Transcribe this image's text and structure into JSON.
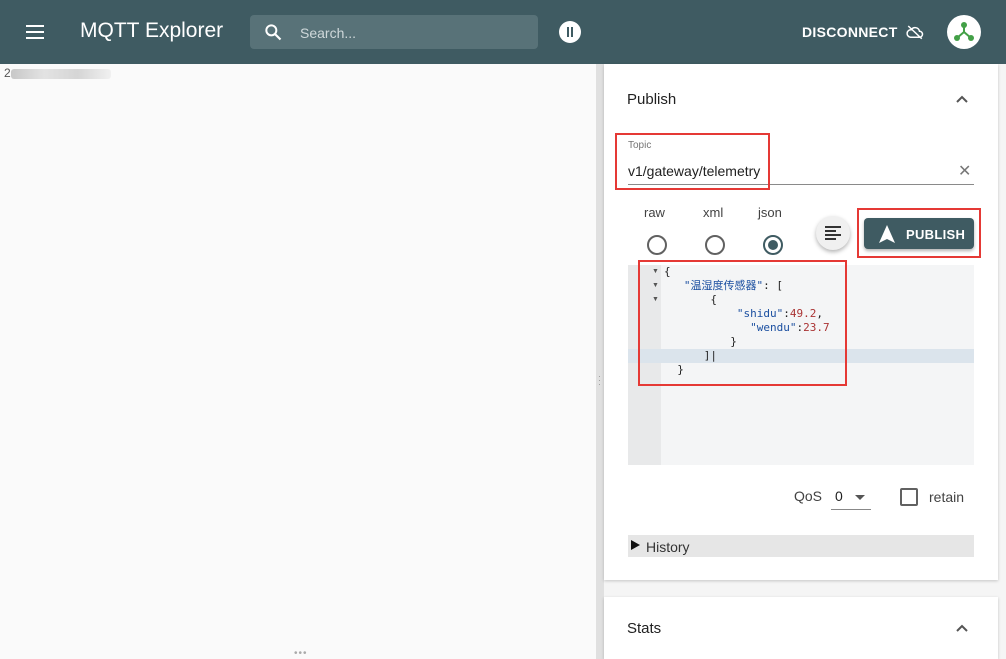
{
  "appbar": {
    "title": "MQTT Explorer",
    "search_placeholder": "Search...",
    "disconnect_label": "DISCONNECT",
    "color": "#3f5b62"
  },
  "tree": {
    "first_node": "2"
  },
  "publish": {
    "title": "Publish",
    "topic_label": "Topic",
    "topic_value": "v1/gateway/telemetry",
    "formats": [
      "raw",
      "xml",
      "json"
    ],
    "selected_format": "json",
    "publish_label": "PUBLISH",
    "editor_lines": [
      {
        "indent": "{",
        "parts": []
      },
      {
        "text": "    \"温湿度传感器\": [",
        "key": "\"温湿度传感器\""
      },
      {
        "text": "        {"
      },
      {
        "text": "            \"shidu\":49.2,",
        "key": "\"shidu\"",
        "value": "49.2"
      },
      {
        "text": "              \"wendu\":23.7",
        "key": "\"wendu\"",
        "value": "23.7"
      },
      {
        "text": "          }"
      },
      {
        "text": "    ]|"
      },
      {
        "text": "}"
      }
    ],
    "qos_label": "QoS",
    "qos_value": "0",
    "retain_label": "retain",
    "history_label": "History"
  },
  "stats": {
    "title": "Stats"
  },
  "highlight_color": "#e53935",
  "icons": [
    "menu-icon",
    "search-icon",
    "pause-icon",
    "cloud-off-icon",
    "connection-avatar-icon",
    "chevron-up-icon",
    "clear-icon",
    "format-align-icon",
    "send-icon",
    "dropdown-icon",
    "triangle-right-icon"
  ]
}
